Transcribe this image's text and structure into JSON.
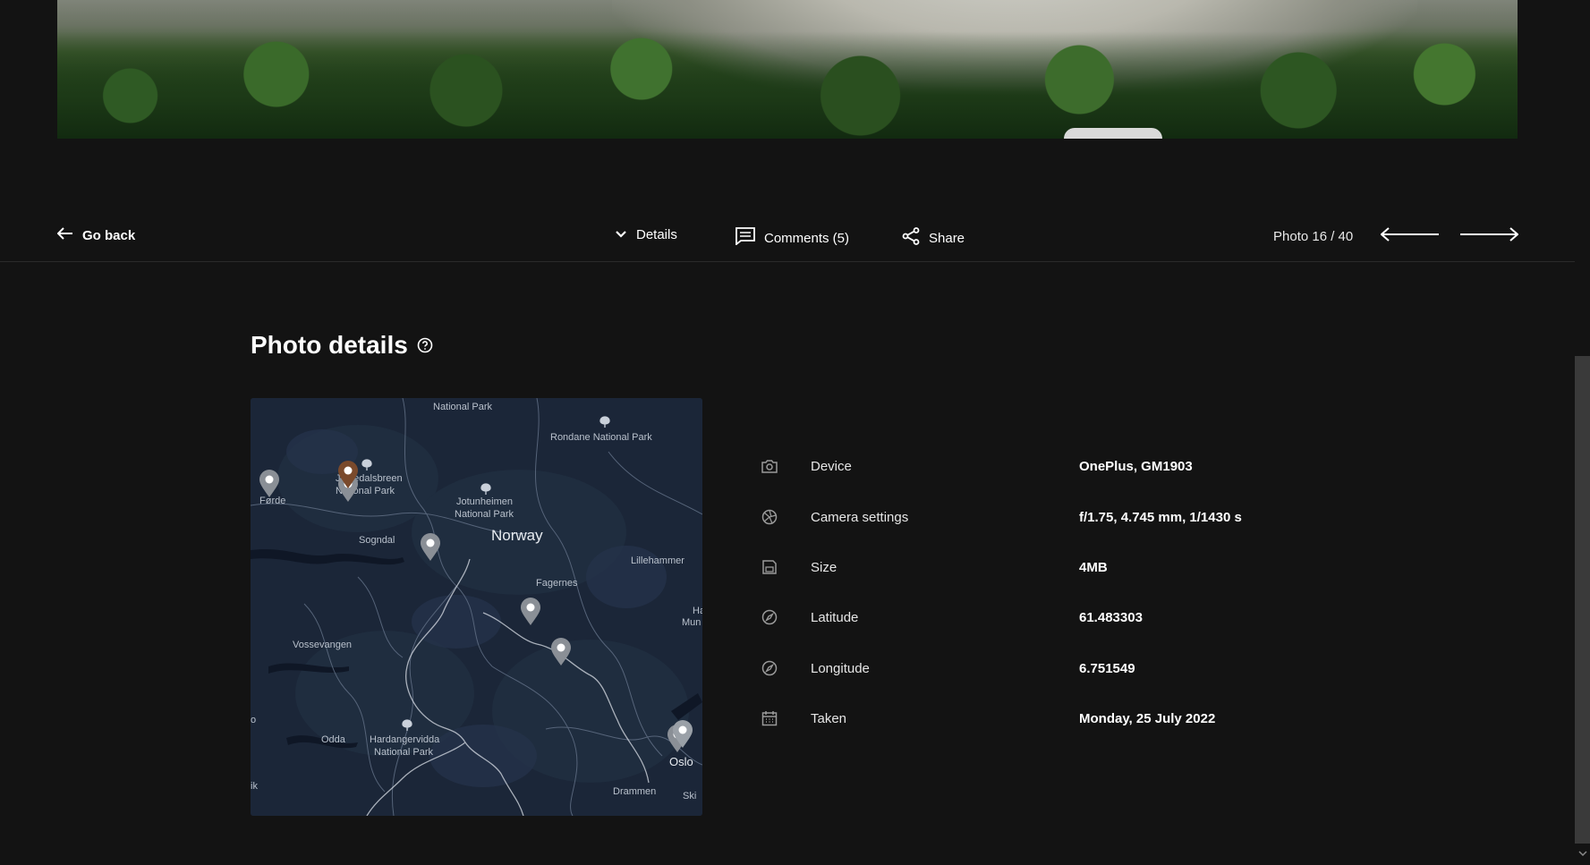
{
  "toolbar": {
    "go_back_label": "Go back",
    "details_label": "Details",
    "comments_label": "Comments (5)",
    "share_label": "Share",
    "photo_counter": "Photo 16 / 40"
  },
  "details": {
    "title": "Photo details",
    "rows": [
      {
        "icon": "camera-icon",
        "label": "Device",
        "value": "OnePlus, GM1903"
      },
      {
        "icon": "aperture-icon",
        "label": "Camera settings",
        "value": "f/1.75, 4.745 mm, 1/1430 s"
      },
      {
        "icon": "save-icon",
        "label": "Size",
        "value": "4MB"
      },
      {
        "icon": "compass-icon",
        "label": "Latitude",
        "value": "61.483303"
      },
      {
        "icon": "compass-icon",
        "label": "Longitude",
        "value": "6.751549"
      },
      {
        "icon": "calendar-icon",
        "label": "Taken",
        "value": "Monday, 25 July 2022"
      }
    ]
  },
  "map": {
    "labels": {
      "national_park_top": "National Park",
      "rondane": "Rondane National Park",
      "jostedalsbreen_1": "Jostedalsbreen",
      "jostedalsbreen_2": "National Park",
      "forde": "Førde",
      "jotunheimen_1": "Jotunheimen",
      "jotunheimen_2": "National Park",
      "sogndal": "Sogndal",
      "norway": "Norway",
      "lillehammer": "Lillehammer",
      "fagernes": "Fagernes",
      "hamar": "Ha",
      "mun": "Mun",
      "vossevangen": "Vossevangen",
      "odda": "Odda",
      "hardangervidda_1": "Hardangervidda",
      "hardangervidda_2": "National Park",
      "oslo": "Oslo",
      "drammen": "Drammen",
      "ski": "Ski",
      "o_edge": "o",
      "ik_edge": "ik"
    }
  },
  "colors": {
    "background": "#131313",
    "map_water": "#1a2436",
    "active_pin": "#7a4a2c",
    "pin": "#8a8f96"
  }
}
